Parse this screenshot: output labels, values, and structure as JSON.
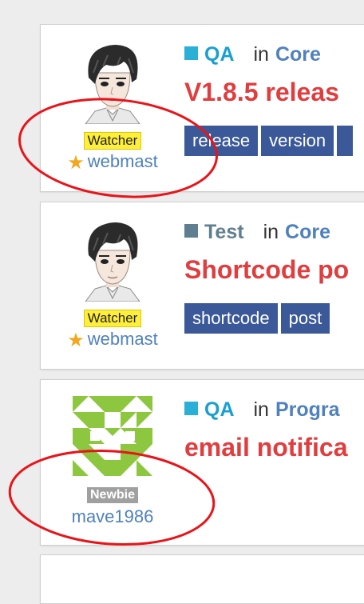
{
  "colors": {
    "qa_square": "#2ab0d6",
    "test_square": "#5e7f8f",
    "category_text_qa": "#1aa0d0",
    "category_text_test": "#5e7f8f",
    "forum_link": "#4f81bd",
    "title": "#e03d3f",
    "tag_bg": "#3b5998",
    "watcher_badge": "#ffef3a",
    "newbie_badge": "#a0a0a0",
    "annotation_circle": "#e8141a"
  },
  "posts": [
    {
      "author": {
        "badge": "Watcher",
        "username": "webmast",
        "avatar": "anime-boy-avatar",
        "star": true
      },
      "category": "QA",
      "in_word": "in",
      "forum": "Core",
      "title": "V1.8.5 releas",
      "tags": [
        "release",
        "version",
        ""
      ]
    },
    {
      "author": {
        "badge": "Watcher",
        "username": "webmast",
        "avatar": "anime-boy-avatar",
        "star": true
      },
      "category": "Test",
      "in_word": "in",
      "forum": "Core",
      "title": "Shortcode po",
      "tags": [
        "shortcode",
        "post"
      ]
    },
    {
      "author": {
        "badge": "Newbie",
        "username": "mave1986",
        "avatar": "green-identicon-avatar",
        "star": false
      },
      "category": "QA",
      "in_word": "in",
      "forum": "Progra",
      "title": "email notifica",
      "tags": []
    }
  ]
}
